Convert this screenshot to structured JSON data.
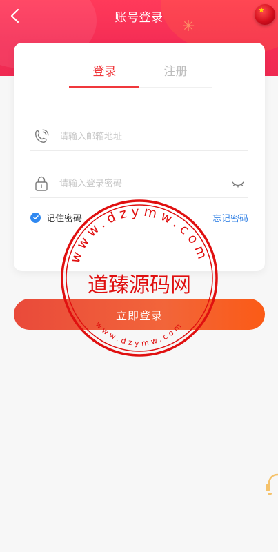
{
  "header": {
    "title": "账号登录",
    "back_icon": "chevron-left-icon",
    "flag_icon": "flag-icon"
  },
  "tabs": [
    {
      "label": "登录",
      "active": true
    },
    {
      "label": "注册",
      "active": false
    }
  ],
  "form": {
    "email_placeholder": "请输入邮箱地址",
    "email_value": "",
    "password_placeholder": "请输入登录密码",
    "password_value": "",
    "remember_label": "记住密码",
    "remember_checked": true,
    "forgot_label": "忘记密码",
    "submit_label": "立即登录"
  },
  "watermark": {
    "top_text": "www.dzymw.com",
    "center_text": "道臻源码网",
    "bottom_text": "www.dzymw.com"
  },
  "colors": {
    "accent": "#f0383c",
    "link": "#3a86e6",
    "button_start": "#e94a3a",
    "button_end": "#fb5b16",
    "stamp": "#e01010"
  }
}
